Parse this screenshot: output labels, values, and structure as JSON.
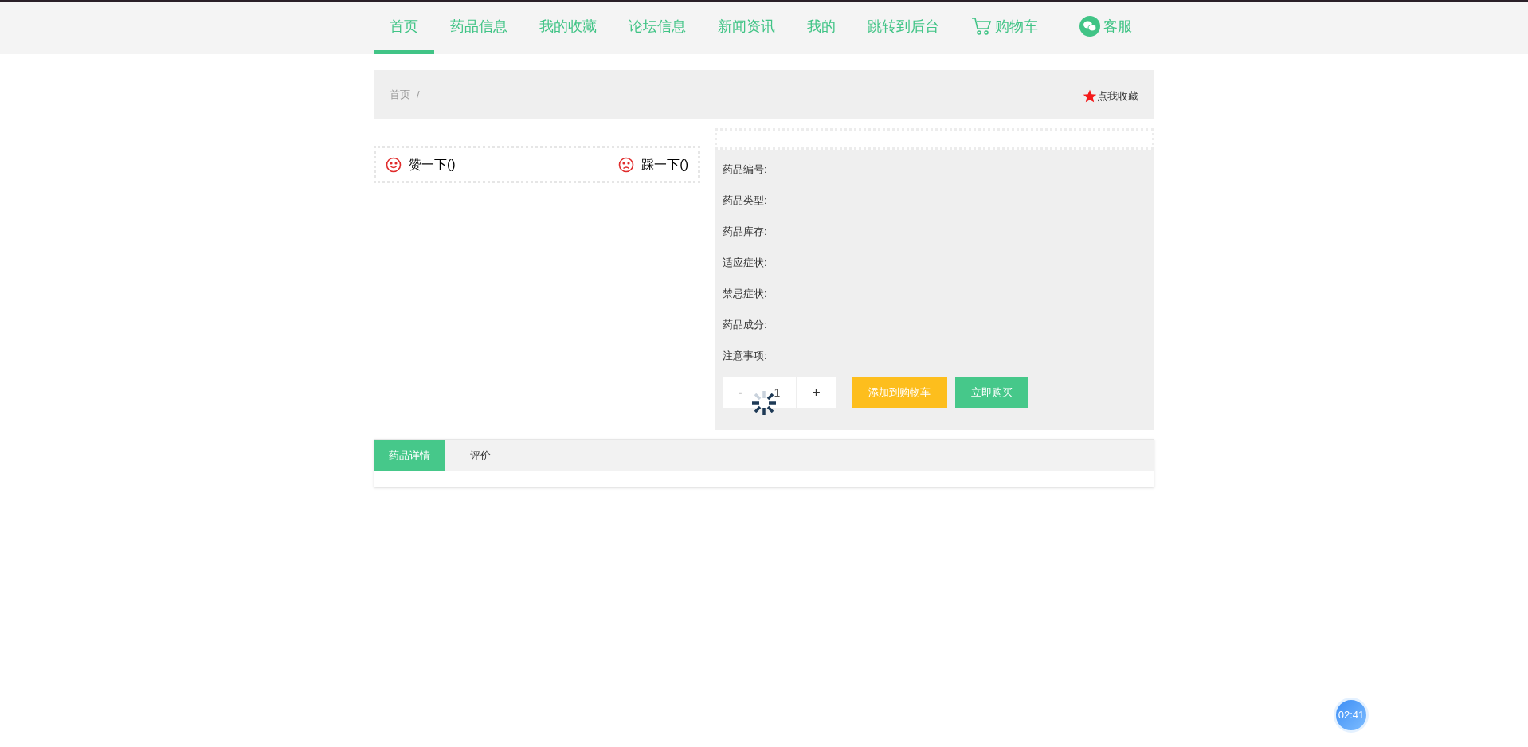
{
  "nav": [
    {
      "label": "首页",
      "selected": true,
      "kind": "text"
    },
    {
      "label": "药品信息",
      "selected": false,
      "kind": "text"
    },
    {
      "label": "我的收藏",
      "selected": false,
      "kind": "text"
    },
    {
      "label": "论坛信息",
      "selected": false,
      "kind": "text"
    },
    {
      "label": "新闻资讯",
      "selected": false,
      "kind": "text"
    },
    {
      "label": "我的",
      "selected": false,
      "kind": "text"
    },
    {
      "label": "跳转到后台",
      "selected": false,
      "kind": "text"
    },
    {
      "label": "购物车",
      "selected": false,
      "kind": "cart"
    },
    {
      "label": "客服",
      "selected": false,
      "kind": "chat"
    }
  ],
  "breadcrumb": {
    "items": [
      "首页"
    ],
    "separator": "/"
  },
  "favorite": "点我收藏",
  "votes": [
    {
      "label": "赞一下()",
      "kind": "like"
    },
    {
      "label": "踩一下()",
      "kind": "dislike"
    }
  ],
  "info_fields": [
    "药品编号:",
    "药品类型:",
    "药品库存:",
    "适应症状:",
    "禁忌症状:",
    "药品成分:",
    "注意事项:"
  ],
  "quantity": {
    "minus": "-",
    "value": "1",
    "plus": "+"
  },
  "buttons": [
    {
      "label": "添加到购物车",
      "kind": "cart"
    },
    {
      "label": "立即购买",
      "kind": "buy"
    }
  ],
  "loading": true,
  "tabs": [
    {
      "label": "药品详情",
      "selected": true
    },
    {
      "label": "评价",
      "selected": false
    }
  ],
  "timer": "02:41"
}
